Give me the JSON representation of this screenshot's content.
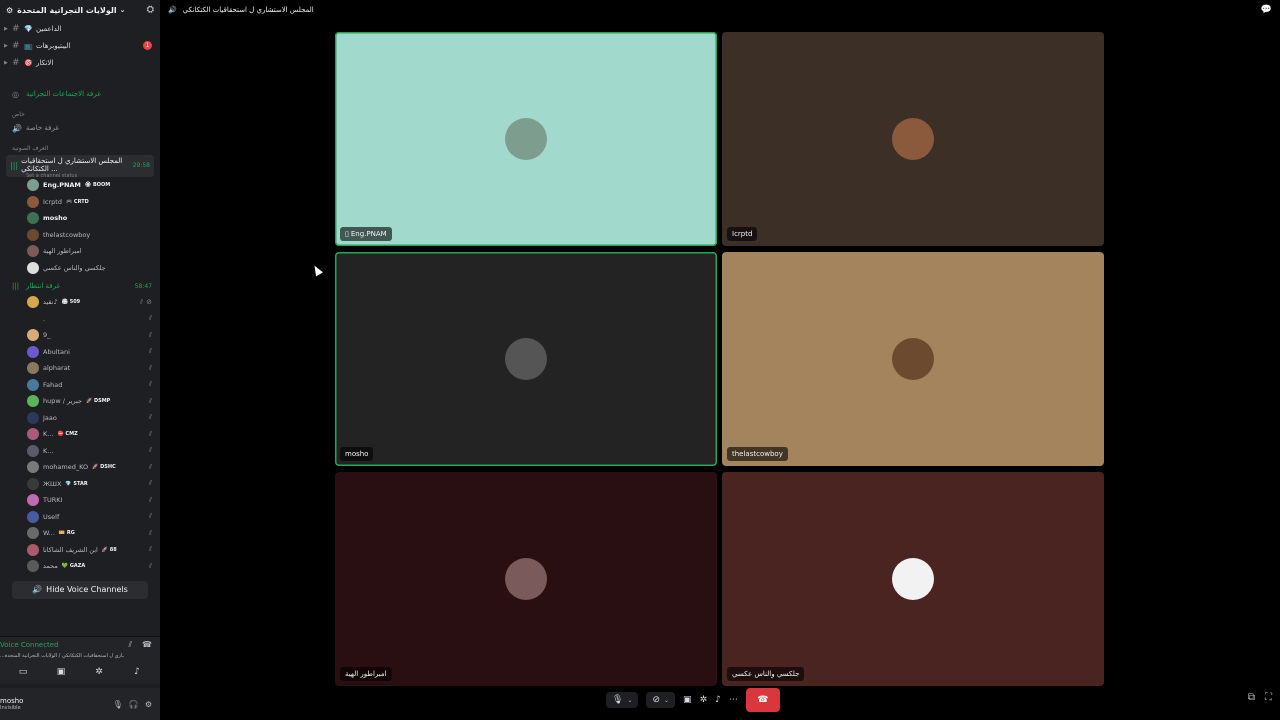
{
  "server": {
    "name": "الولايات التجراتية المتحدة"
  },
  "folders": [
    {
      "emoji": "💎",
      "label": "الداعمين",
      "badge": ""
    },
    {
      "emoji": "📺",
      "label": "اليبتيوبرهات",
      "badge": "1"
    },
    {
      "emoji": "🎯",
      "label": "الاتكار",
      "badge": ""
    }
  ],
  "channels": {
    "meetings": "غرفة الاجتماعات التجراتية",
    "private_label": "خاص",
    "private_room": "غرفة خاصة",
    "voice_label": "الغرف الصوتية"
  },
  "active_channel": {
    "name": "المجلس الاستشاري ل استحقاقيات الكتكانكي ...",
    "timer": "29:58",
    "status_placeholder": "Set a channel status"
  },
  "active_users": [
    {
      "name": "Eng.PNAM",
      "tag": "🏵 BOOM",
      "bold": true,
      "color": "#7d9e8f"
    },
    {
      "name": "Icrptd",
      "tag": "🎮 CRTD",
      "bold": false,
      "color": "#8b5a3c"
    },
    {
      "name": "mosho",
      "tag": "",
      "bold": true,
      "color": "#3f6f55"
    },
    {
      "name": "thelastcowboy",
      "tag": "",
      "bold": false,
      "color": "#6b4a2f"
    },
    {
      "name": "امبراطور الهية",
      "tag": "",
      "bold": false,
      "color": "#7a5a5a"
    },
    {
      "name": "جلكسي والناس عكسي",
      "tag": "",
      "bold": false,
      "color": "#dddddd"
    }
  ],
  "second_channel": {
    "name": "غرفة انتظار",
    "timer": "58:47"
  },
  "waiting_users": [
    {
      "name": "نقيد♪",
      "tag": "🏟 509",
      "color": "#d4a84b",
      "extra": true
    },
    {
      "name": ".",
      "tag": "",
      "color": "#1e1f22",
      "extra": false
    },
    {
      "name": "9_",
      "tag": "",
      "color": "#d9a97a",
      "extra": false
    },
    {
      "name": "Abultani",
      "tag": "",
      "color": "#6a5acd",
      "extra": false
    },
    {
      "name": "alpharat",
      "tag": "",
      "color": "#8a7a5a",
      "extra": false
    },
    {
      "name": "Fahad",
      "tag": "",
      "color": "#4a7a9a",
      "extra": false
    },
    {
      "name": "hupw / جبرير",
      "tag": "🚀 DSMP",
      "color": "#5ab45a",
      "extra": false
    },
    {
      "name": "Jaao",
      "tag": "",
      "color": "#2a3a5a",
      "extra": false
    },
    {
      "name": "K...",
      "tag": "⛔ CMZ",
      "color": "#aa5a7a",
      "extra": false
    },
    {
      "name": "K...",
      "tag": "",
      "color": "#5a5a6a",
      "extra": false
    },
    {
      "name": "mohamed_KO",
      "tag": "🚀 DSHC",
      "color": "#7a7a7a",
      "extra": false
    },
    {
      "name": "ЖШX",
      "tag": "💎 STAR",
      "color": "#3a3a3a",
      "extra": false
    },
    {
      "name": "TURKI",
      "tag": "",
      "color": "#c06ab0",
      "extra": false
    },
    {
      "name": "Uself",
      "tag": "",
      "color": "#4a5aa0",
      "extra": false
    },
    {
      "name": "W...",
      "tag": "🎫 RG",
      "color": "#6a6a6a",
      "extra": false
    },
    {
      "name": "ابن الشريف الشاكانا",
      "tag": "🚀 88",
      "color": "#aa5a6a",
      "extra": false
    },
    {
      "name": "محمد",
      "tag": "💚 GAZA",
      "color": "#5a5a5a",
      "extra": false
    }
  ],
  "hide_voice": "Hide Voice Channels",
  "voice_panel": {
    "status": "Voice Connected",
    "sub": "...ـاري ل استحقاقيات الكتكانكي / الولايات التجراتية المتحدة"
  },
  "user_panel": {
    "name": "mosho",
    "status": "Invisible"
  },
  "topbar": {
    "title": "المجلس الاستشاري ل استحقاقيات الكتكانكي"
  },
  "tiles": [
    {
      "name": "Eng.PNAM",
      "bg": "#a1d9cd",
      "avatar_color": "#7d9e8f",
      "speaking": true,
      "mobile": true
    },
    {
      "name": "Icrptd",
      "bg": "#3b2f26",
      "avatar_color": "#8b5a3c",
      "speaking": false,
      "mobile": false
    },
    {
      "name": "mosho",
      "bg": "#232323",
      "avatar_color": "#555555",
      "speaking": true,
      "mobile": false
    },
    {
      "name": "thelastcowboy",
      "bg": "#a3845d",
      "avatar_color": "#6b4a2f",
      "speaking": false,
      "mobile": false
    },
    {
      "name": "امبراطور الهية",
      "bg": "#2a0f12",
      "avatar_color": "#7a5a5a",
      "speaking": false,
      "mobile": false
    },
    {
      "name": "جلكسي والناس عكسي",
      "bg": "#4a2420",
      "avatar_color": "#f2f2f2",
      "speaking": false,
      "mobile": false
    }
  ]
}
